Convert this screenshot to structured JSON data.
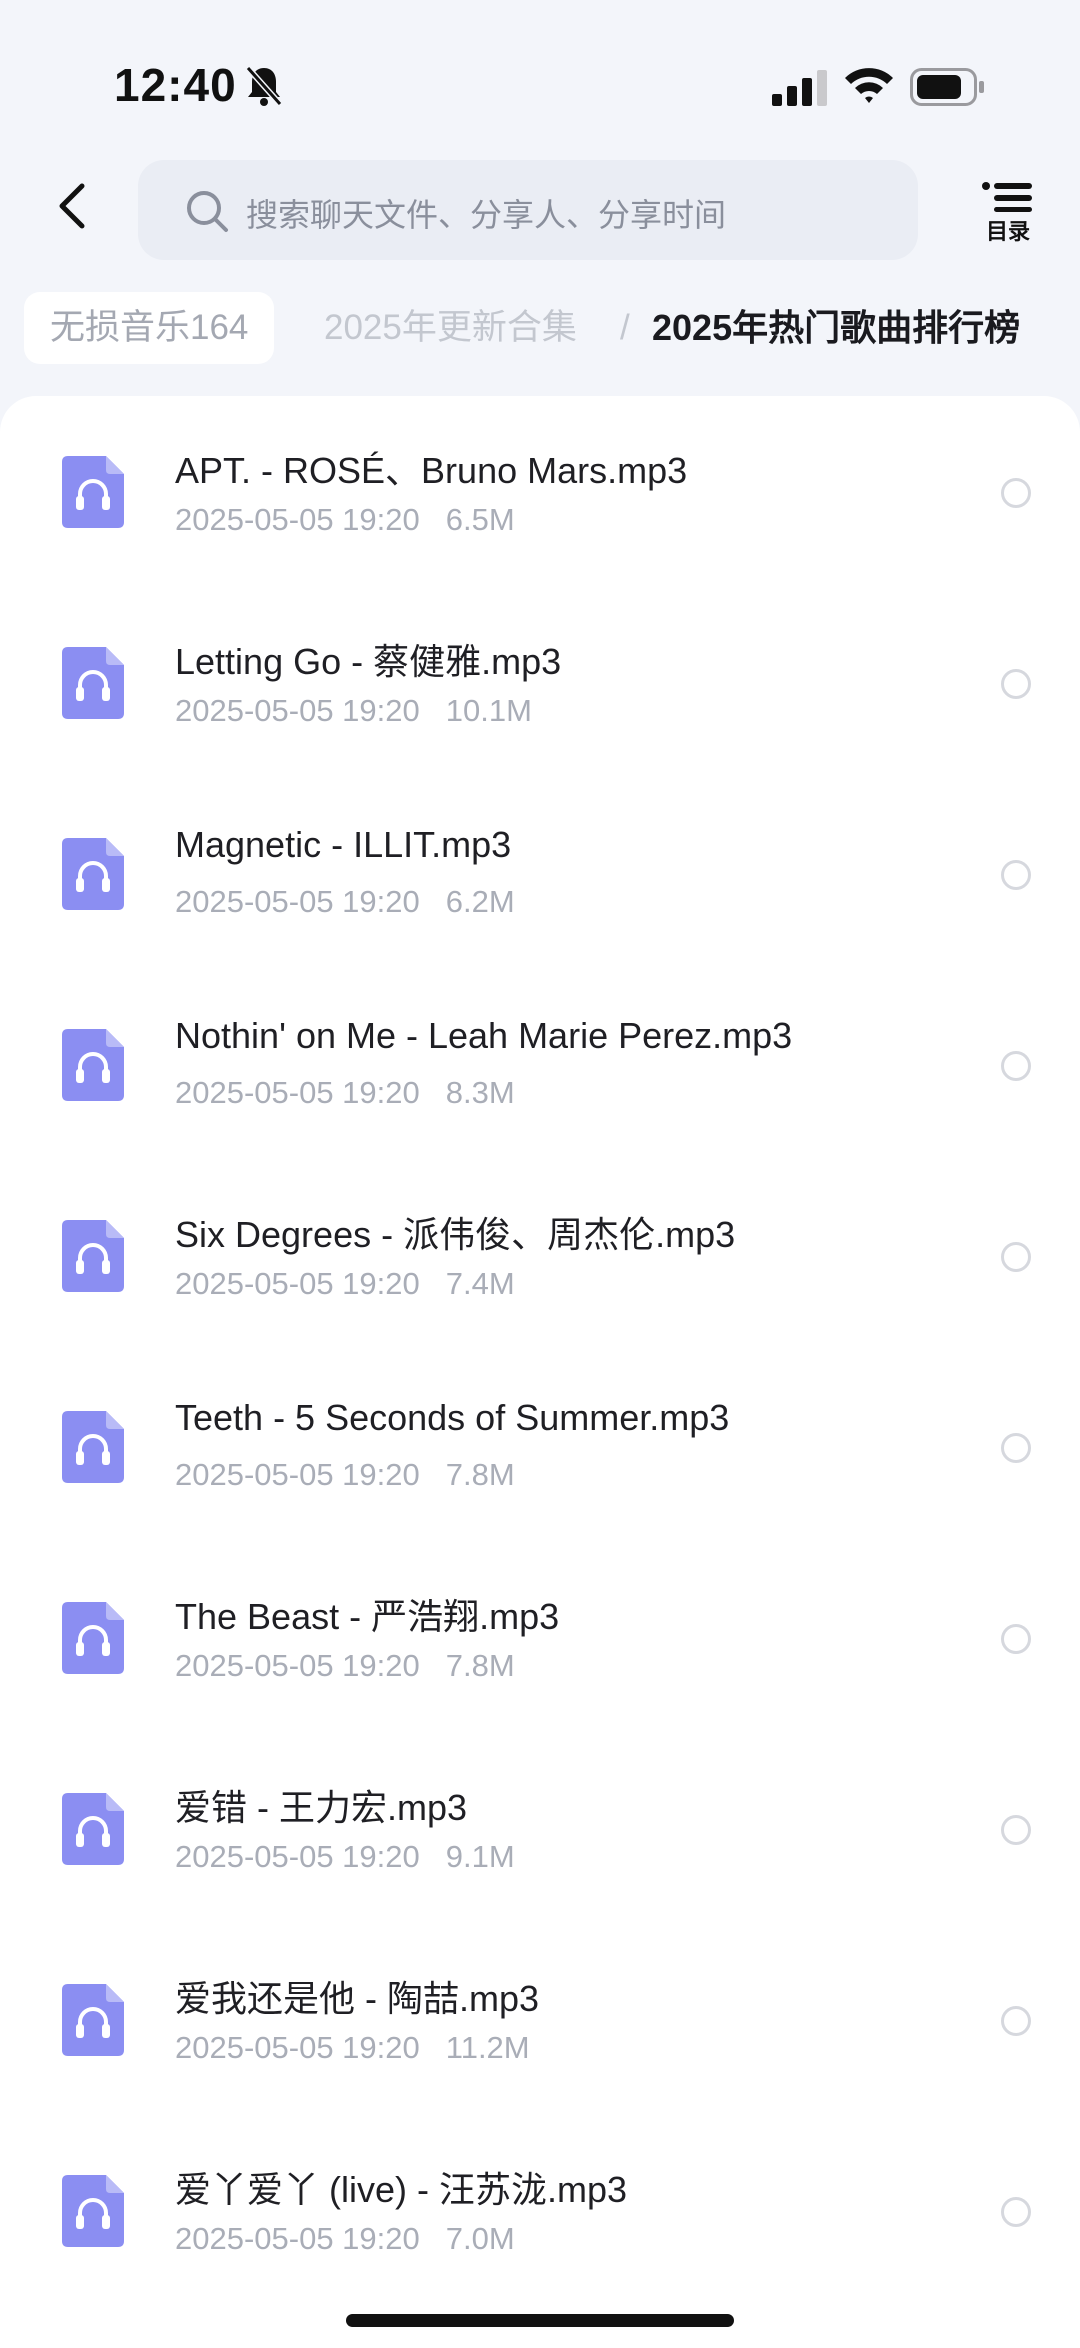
{
  "status_bar": {
    "time": "12:40"
  },
  "search": {
    "placeholder": "搜索聊天文件、分享人、分享时间"
  },
  "toc": {
    "label": "目录"
  },
  "breadcrumb": {
    "items": [
      "无损音乐164",
      "2025年更新合集",
      "2025年热门歌曲排行榜"
    ],
    "separator": "/"
  },
  "files": [
    {
      "name": "APT. - ROSÉ、Bruno Mars.mp3",
      "date": "2025-05-05 19:20",
      "size": "6.5M"
    },
    {
      "name": "Letting Go - 蔡健雅.mp3",
      "date": "2025-05-05 19:20",
      "size": "10.1M"
    },
    {
      "name": "Magnetic - ILLIT.mp3",
      "date": "2025-05-05 19:20",
      "size": "6.2M"
    },
    {
      "name": "Nothin' on Me - Leah Marie Perez.mp3",
      "date": "2025-05-05 19:20",
      "size": "8.3M"
    },
    {
      "name": "Six Degrees - 派伟俊、周杰伦.mp3",
      "date": "2025-05-05 19:20",
      "size": "7.4M"
    },
    {
      "name": "Teeth - 5 Seconds of Summer.mp3",
      "date": "2025-05-05 19:20",
      "size": "7.8M"
    },
    {
      "name": "The Beast - 严浩翔.mp3",
      "date": "2025-05-05 19:20",
      "size": "7.8M"
    },
    {
      "name": "爱错 - 王力宏.mp3",
      "date": "2025-05-05 19:20",
      "size": "9.1M"
    },
    {
      "name": "爱我还是他 - 陶喆.mp3",
      "date": "2025-05-05 19:20",
      "size": "11.2M"
    },
    {
      "name": "爱丫爱丫 (live) - 汪苏泷.mp3",
      "date": "2025-05-05 19:20",
      "size": "7.0M"
    }
  ],
  "colors": {
    "file_icon": "#8b8ef2",
    "accent_text": "#1a1a1f",
    "meta_text": "#a9adb7"
  },
  "icons": {
    "back": "chevron-left-icon",
    "search": "search-icon",
    "toc": "list-icon",
    "file": "audio-file-icon",
    "select": "radio-icon"
  }
}
